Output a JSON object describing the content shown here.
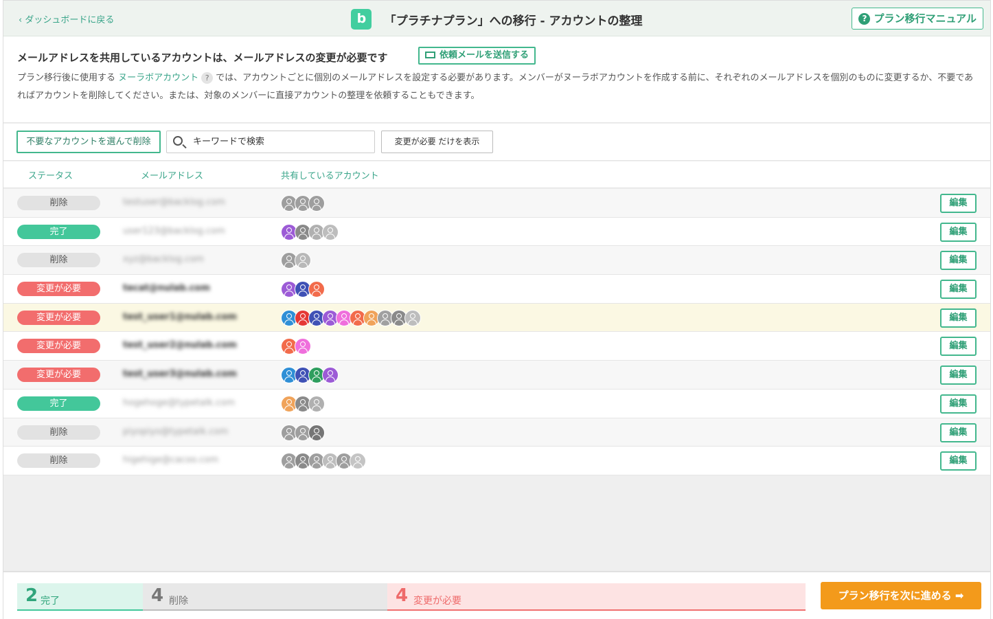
{
  "header": {
    "back_label": "ダッシュボードに戻る",
    "logo_letter": "b",
    "title": "「プラチナプラン」への移行 - アカウントの整理",
    "manual_label": "プラン移行マニュアル"
  },
  "notice": {
    "heading": "メールアドレスを共用しているアカウントは、メールアドレスの変更が必要です",
    "request_mail_label": "依頼メールを送信する",
    "desc_prefix": "プラン移行後に使用する",
    "desc_link": "ヌーラボアカウント",
    "desc_suffix": "では、アカウントごとに個別のメールアドレスを設定する必要があります。メンバーがヌーラボアカウントを作成する前に、それぞれのメールアドレスを個別のものに変更するか、不要であればアカウントを削除してください。または、対象のメンバーに直接アカウントの整理を依頼することもできます。"
  },
  "toolbar": {
    "delete_label": "不要なアカウントを選んで削除",
    "search_placeholder": "キーワードで検索",
    "filter_label": "変更が必要 だけを表示"
  },
  "table": {
    "columns": [
      "ステータス",
      "メールアドレス",
      "共有しているアカウント"
    ],
    "edit_label": "編集",
    "rows": [
      {
        "status": "削除",
        "kind": "del",
        "email": "testuser@backlog.com",
        "avatars": [
          "#9e9e9e",
          "#9e9e9e",
          "#9e9e9e"
        ]
      },
      {
        "status": "完了",
        "kind": "done",
        "email": "user123@backlog.com",
        "avatars": [
          "#9c5bd6",
          "#8a8a8a",
          "#b0b0b0",
          "#bdbdbd"
        ]
      },
      {
        "status": "削除",
        "kind": "del",
        "email": "xyz@backlog.com",
        "avatars": [
          "#9e9e9e",
          "#b8b8b8"
        ]
      },
      {
        "status": "変更が必要",
        "kind": "need",
        "email": "tecat@nulab.com",
        "avatars": [
          "#9c5bd6",
          "#3f51b5",
          "#f26b4b"
        ]
      },
      {
        "status": "変更が必要",
        "kind": "need",
        "email": "test_user1@nulab.com",
        "avatars": [
          "#2f8fd6",
          "#e53935",
          "#3f51b5",
          "#9c5bd6",
          "#ef6fdc",
          "#f26b4b",
          "#f0a35a",
          "#a0a0a0",
          "#8a8a8a",
          "#bdbdbd"
        ]
      },
      {
        "status": "変更が必要",
        "kind": "need",
        "email": "test_user2@nulab.com",
        "avatars": [
          "#f26b4b",
          "#ef6fdc"
        ]
      },
      {
        "status": "変更が必要",
        "kind": "need",
        "email": "test_user3@nulab.com",
        "avatars": [
          "#2f8fd6",
          "#3f51b5",
          "#2e9e5e",
          "#9c5bd6"
        ]
      },
      {
        "status": "完了",
        "kind": "done",
        "email": "hogehoge@typetalk.com",
        "avatars": [
          "#f0a35a",
          "#8a8a8a",
          "#b0b0b0"
        ]
      },
      {
        "status": "削除",
        "kind": "del",
        "email": "piyopiyo@typetalk.com",
        "avatars": [
          "#9e9e9e",
          "#9e9e9e",
          "#757575"
        ]
      },
      {
        "status": "削除",
        "kind": "del",
        "email": "higehige@cacoo.com",
        "avatars": [
          "#9e9e9e",
          "#8a8a8a",
          "#9e9e9e",
          "#bdbdbd",
          "#9e9e9e",
          "#c4c4c4"
        ]
      }
    ]
  },
  "summary": {
    "done_count": "2",
    "done_label": "完了",
    "deleted_count": "4",
    "deleted_label": "削除",
    "need_count": "4",
    "need_label": "変更が必要",
    "next_label": "プラン移行を次に進める ➡"
  }
}
